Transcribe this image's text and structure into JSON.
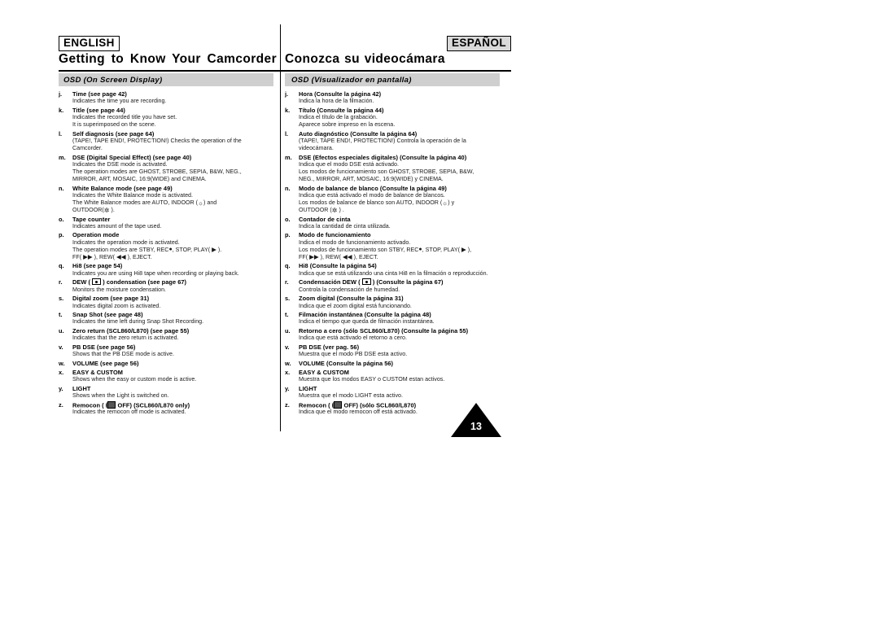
{
  "header": {
    "lang_left": "ENGLISH",
    "lang_right": "ESPAÑOL",
    "title_left": "Getting to Know Your Camcorder",
    "title_right": "Conozca su videocámara"
  },
  "page_number": "13",
  "left": {
    "section_title": "OSD (On Screen Display)",
    "entries": [
      {
        "mark": "j.",
        "term": "Time (see page 42)",
        "desc": [
          "Indicates the time you are recording."
        ]
      },
      {
        "mark": "k.",
        "term": "Title (see page 44)",
        "desc": [
          "Indicates the recorded title you have set.",
          "It is superimposed on the scene."
        ]
      },
      {
        "mark": "l.",
        "term": "Self diagnosis (see page 64)",
        "desc": [
          "(TAPE!, TAPE END!, PROTECTION!) Checks the operation of the",
          "Camcorder."
        ]
      },
      {
        "mark": "m.",
        "term": "DSE (Digital Special Effect) (see page 40)",
        "desc": [
          "Indicates the DSE mode is activated.",
          "The operation modes are GHOST, STROBE, SEPIA, B&W, NEG.,",
          "MIRROR, ART, MOSAIC, 16:9(WIDE) and CINEMA."
        ]
      },
      {
        "mark": "n.",
        "term": "White Balance mode (see page 49)",
        "desc_html": [
          "Indicates the White Balance mode is activated.",
          "The White Balance modes are AUTO, INDOOR (<span class=\"gl icon-lamp\">☼</span>) and",
          "OUTDOOR(<span class=\"gl icon-sun\">✲</span> )."
        ]
      },
      {
        "mark": "o.",
        "term": "Tape counter",
        "desc": [
          "Indicates amount of the tape used."
        ]
      },
      {
        "mark": "p.",
        "term": "Operation mode",
        "desc_html": [
          "Indicates the operation mode is activated.",
          "The operation modes are STBY, REC<span class=\"gl rec-dot\">●</span>, STOP, PLAY( <span class=\"gl tri-play\">▶</span> ).",
          "FF( <span class=\"gl tri-play\">▶▶</span> ), REW( <span class=\"gl tri-play\">◀◀</span> ), EJECT."
        ]
      },
      {
        "mark": "q.",
        "term": "Hi8 (see page 54)",
        "desc": [
          "Indicates you are using Hi8 tape when recording or playing back."
        ]
      },
      {
        "mark": "r.",
        "term_html": "DEW ( <span class=\"gl icon-box\"></span> ) condensation (see page 67)",
        "desc": [
          "Monitors the moisture condensation."
        ]
      },
      {
        "mark": "s.",
        "term": "Digital zoom (see page 31)",
        "desc": [
          "Indicates digital zoom is activated."
        ]
      },
      {
        "mark": "t.",
        "term": "Snap Shot (see page 48)",
        "desc": [
          "Indicates the time left during Snap Shot Recording."
        ]
      },
      {
        "mark": "u.",
        "term": "Zero return (SCL860/L870) (see page 55)",
        "desc": [
          "Indicates that the zero return is activated."
        ]
      },
      {
        "mark": "v.",
        "term": "PB DSE (see page 56)",
        "desc": [
          "Shows that the PB DSE mode is active."
        ]
      },
      {
        "mark": "w.",
        "term": "VOLUME  (see page 56)",
        "desc": []
      },
      {
        "mark": "x.",
        "term": "EASY & CUSTOM",
        "desc": [
          "Shows when the easy or custom mode is active."
        ]
      },
      {
        "mark": "y.",
        "term": "LIGHT",
        "desc": [
          "Shows when the Light is switched on."
        ]
      },
      {
        "mark": "z.",
        "term_html": "Remocon ( <span class=\"gl icon-wave\">((</span><span class=\"gl icon-remote\"></span> OFF) (SCL860/L870 only)",
        "desc": [
          "Indicates the remocon off mode is activated."
        ]
      }
    ]
  },
  "right": {
    "section_title": "OSD (Visualizador en pantalla)",
    "entries": [
      {
        "mark": "j.",
        "term": "Hora (Consulte la página 42)",
        "desc": [
          "Indica la hora de la filmación."
        ]
      },
      {
        "mark": "k.",
        "term": "Título (Consulte la página 44)",
        "desc": [
          "Indica el título de la grabación.",
          "Aparece sobre impreso en la escena."
        ]
      },
      {
        "mark": "l.",
        "term": "Auto diagnóstico (Consulte la página 64)",
        "desc": [
          "(TAPE!, TAPE END!, PROTECTION!) Controla la operación de la",
          "videocámara."
        ]
      },
      {
        "mark": "m.",
        "term": "DSE (Efectos especiales digitales) (Consulte la página 40)",
        "desc": [
          "Indica que el modo DSE está activado.",
          "Los modos de funcionamiento son GHOST, STROBE, SEPIA, B&W,",
          "NEG., MIRROR, ART, MOSAIC, 16:9(WIDE) y CINEMA."
        ]
      },
      {
        "mark": "n.",
        "term": "Modo de balance de blanco (Consulte la página 49)",
        "desc_html": [
          "Indica que está activado el modo de balance de blancos.",
          "Los modos de balance de blanco son AUTO, INDOOR (<span class=\"gl icon-lamp\">☼</span>) y",
          "OUTDOOR (<span class=\"gl icon-sun\">✲</span> ) ."
        ]
      },
      {
        "mark": "o.",
        "term": "Contador de cinta",
        "desc": [
          "Indica la cantidad de cinta utilizada."
        ]
      },
      {
        "mark": "p.",
        "term": "Modo de funcionamiento",
        "desc_html": [
          "Indica el modo de funcionamiento activado.",
          "Los modos de funcionamiento son STBY, REC<span class=\"gl rec-dot\">●</span>, STOP, PLAY( <span class=\"gl tri-play\">▶</span> ),",
          "FF( <span class=\"gl tri-play\">▶▶</span> ), REW( <span class=\"gl tri-play\">◀◀</span> ), EJECT."
        ]
      },
      {
        "mark": "q.",
        "term": "Hi8 (Consulte la página 54)",
        "desc": [
          "Indica que se está utilizando una cinta Hi8 en la filmación o reproducción."
        ]
      },
      {
        "mark": "r.",
        "term_html": "Condensación DEW ( <span class=\"gl icon-box\"></span> ) (Consulte la página 67)",
        "desc": [
          "Controla la condensación de humedad."
        ]
      },
      {
        "mark": "s.",
        "term": "Zoom digital (Consulte la página 31)",
        "desc": [
          "Indica que el zoom digital está funcionando."
        ]
      },
      {
        "mark": "t.",
        "term": "Filmación instantánea (Consulte la página 48)",
        "desc": [
          "Indica el tiempo que queda de filmación instantánea."
        ]
      },
      {
        "mark": "u.",
        "term": "Retorno a cero (sólo SCL860/L870) (Consulte la página 55)",
        "desc": [
          "Indica que está activado el retorno a cero."
        ]
      },
      {
        "mark": "v.",
        "term": "PB DSE (ver pag. 56)",
        "desc": [
          "Muestra que el modo PB DSE esta activo."
        ]
      },
      {
        "mark": "w.",
        "term": "VOLUME (Consulte la página 56)",
        "desc": []
      },
      {
        "mark": "x.",
        "term": "EASY & CUSTOM",
        "desc": [
          "Muestra que los modos EASY o CUSTOM estan activos."
        ]
      },
      {
        "mark": "y.",
        "term": "LIGHT",
        "desc": [
          "Muestra que el modo LIGHT esta activo."
        ]
      },
      {
        "mark": "z.",
        "term_html": "Remocon ( <span class=\"gl icon-wave\">((</span><span class=\"gl icon-remote\"></span> OFF) (sólo SCL860/L870)",
        "desc": [
          "Indica que el modo remocon off está activado."
        ]
      }
    ]
  }
}
